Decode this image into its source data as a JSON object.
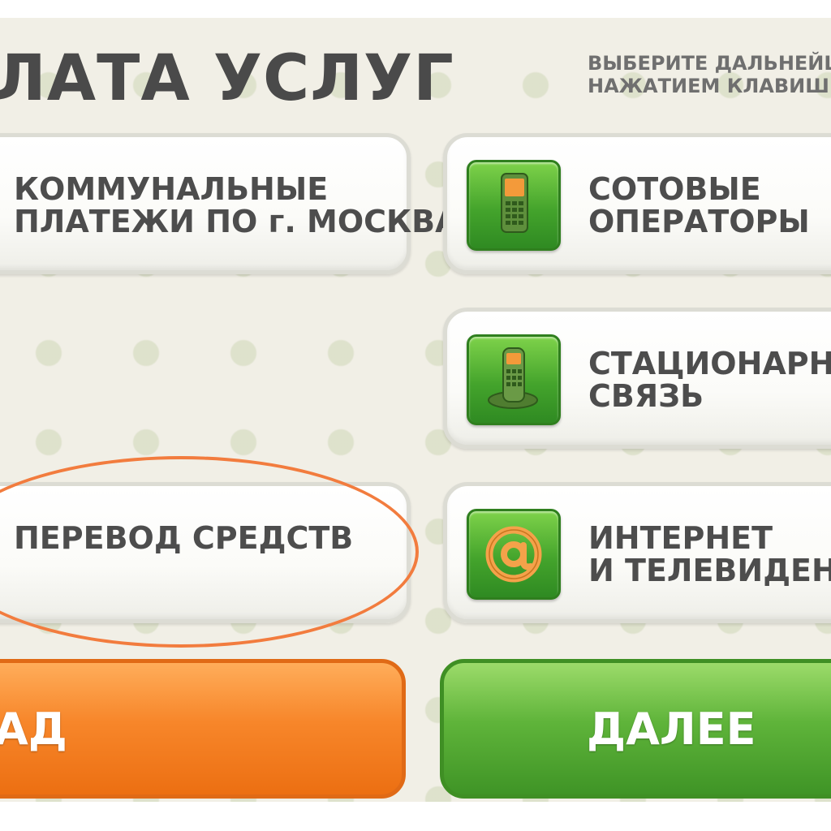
{
  "header": {
    "title": "ЛАТА УСЛУГ",
    "hint_line1": "ВЫБЕРИТЕ ДАЛЬНЕЙШ",
    "hint_line2": "НАЖАТИЕМ КЛАВИШИ"
  },
  "menu": {
    "utilities": {
      "line1": "КОММУНАЛЬНЫЕ",
      "line2": "ПЛАТЕЖИ ПО г. МОСКВА"
    },
    "mobile": {
      "line1": "СОТОВЫЕ",
      "line2": "ОПЕРАТОРЫ",
      "icon": "mobile-phone-icon"
    },
    "landline": {
      "line1": "СТАЦИОНАРНАЯ",
      "line2": "СВЯЗЬ",
      "icon": "cordless-phone-icon"
    },
    "transfer": {
      "line1": "ПЕРЕВОД СРЕДСТВ"
    },
    "internet": {
      "line1": "ИНТЕРНЕТ",
      "line2": "И ТЕЛЕВИДЕНИЕ",
      "icon": "at-sign-icon"
    }
  },
  "buttons": {
    "back_label": "АД",
    "next_label": "ДАЛЕЕ"
  },
  "colors": {
    "background": "#f1efe6",
    "text": "#4d4d4d",
    "brand_green": "#44a42c",
    "back_orange": "#f7862a",
    "highlight": "#f27c3e"
  }
}
